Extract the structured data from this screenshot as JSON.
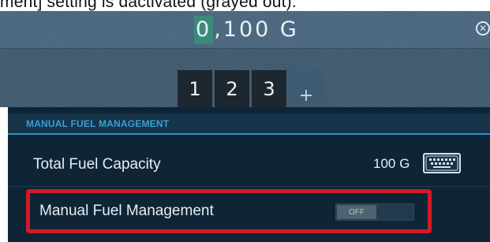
{
  "document": {
    "caption": "ment] setting is dactivated (grayed out)."
  },
  "entry": {
    "value_cursor_digit": "0",
    "value_rest": ",100 G",
    "close_symbol": "⊗",
    "digit_keys": [
      "1",
      "2",
      "3"
    ],
    "plus_symbol": "+"
  },
  "settings": {
    "section_title": "MANUAL FUEL MANAGEMENT",
    "fuel_capacity": {
      "label": "Total Fuel Capacity",
      "value": "100 G"
    },
    "manual_fuel_management": {
      "label": "Manual Fuel Management",
      "toggle_state": "OFF"
    }
  },
  "icons": {
    "close": "close-icon",
    "keyboard": "keyboard-icon"
  },
  "colors": {
    "accent": "#2e95c6",
    "highlight": "#d11a2a",
    "cursor": "#3c8a7a",
    "panel_dark": "#0f2536"
  }
}
